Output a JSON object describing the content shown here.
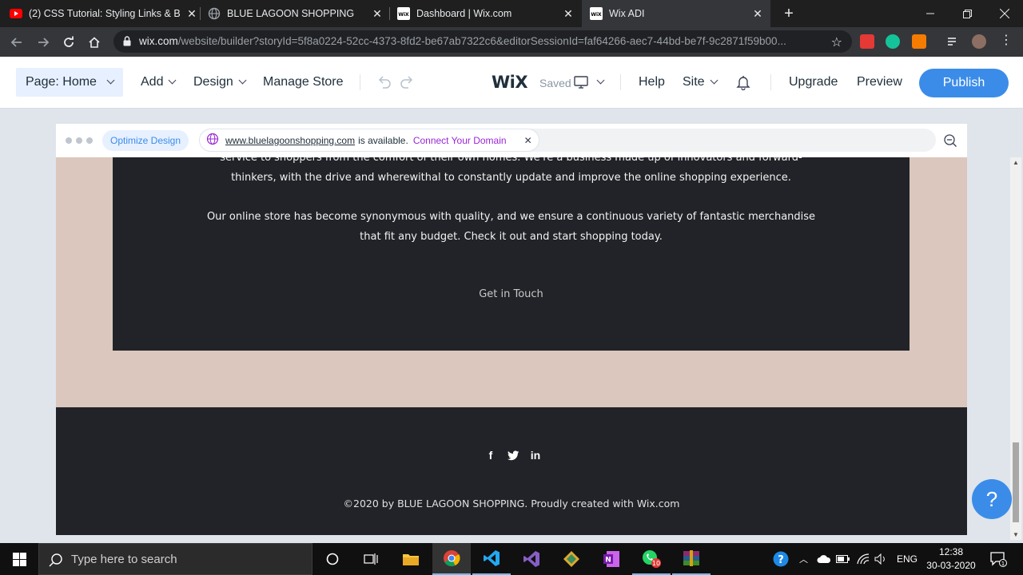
{
  "browser": {
    "tabs": [
      {
        "title": "(2) CSS Tutorial: Styling Links & B",
        "favicon": "youtube-icon",
        "active": false
      },
      {
        "title": "BLUE LAGOON SHOPPING",
        "favicon": "globe-icon",
        "active": false
      },
      {
        "title": "Dashboard | Wix.com",
        "favicon": "wix-icon",
        "active": false
      },
      {
        "title": "Wix ADI",
        "favicon": "wix-icon",
        "active": true
      }
    ],
    "url_host": "wix.com",
    "url_path": "/website/builder?storyId=5f8a0224-52cc-4373-8fd2-be67ab7322c6&editorSessionId=faf64266-aec7-44bd-be7f-9c2871f59b00..."
  },
  "editor": {
    "page_label": "Page: Home",
    "menu": {
      "add": "Add",
      "design": "Design",
      "manage_store": "Manage Store"
    },
    "logo": "WiX",
    "saved": "Saved",
    "help": "Help",
    "site": "Site",
    "upgrade": "Upgrade",
    "preview": "Preview",
    "publish": "Publish"
  },
  "site_bar": {
    "optimize": "Optimize Design",
    "domain": "www.bluelagoonshopping.com",
    "available": "is available.",
    "connect": "Connect Your Domain"
  },
  "site": {
    "cut_text": "service to shoppers from the comfort of their own homes. We're a business made up of innovators and forward-",
    "p1": "thinkers, with the drive and wherewithal to constantly update and improve the online shopping experience.",
    "p2_line1": "Our online store has become synonymous with quality, and we ensure a continuous variety of fantastic merchandise",
    "p2_line2": "that fit any budget. Check it out and start shopping today.",
    "cta": "Get in Touch",
    "social": {
      "facebook": "f",
      "twitter": "t",
      "linkedin": "in"
    },
    "copyright": "©2020 by BLUE LAGOON SHOPPING. Proudly created with Wix.com"
  },
  "help_bubble": "?",
  "taskbar": {
    "search_placeholder": "Type here to search",
    "whatsapp_badge": "10",
    "language": "ENG",
    "time": "12:38",
    "date": "30-03-2020",
    "notification_badge": "1"
  },
  "colors": {
    "wix_blue": "#3b8ce9",
    "connect_purple": "#9a27d5",
    "site_bg": "#dbc7bd",
    "dark_section": "#222328"
  }
}
